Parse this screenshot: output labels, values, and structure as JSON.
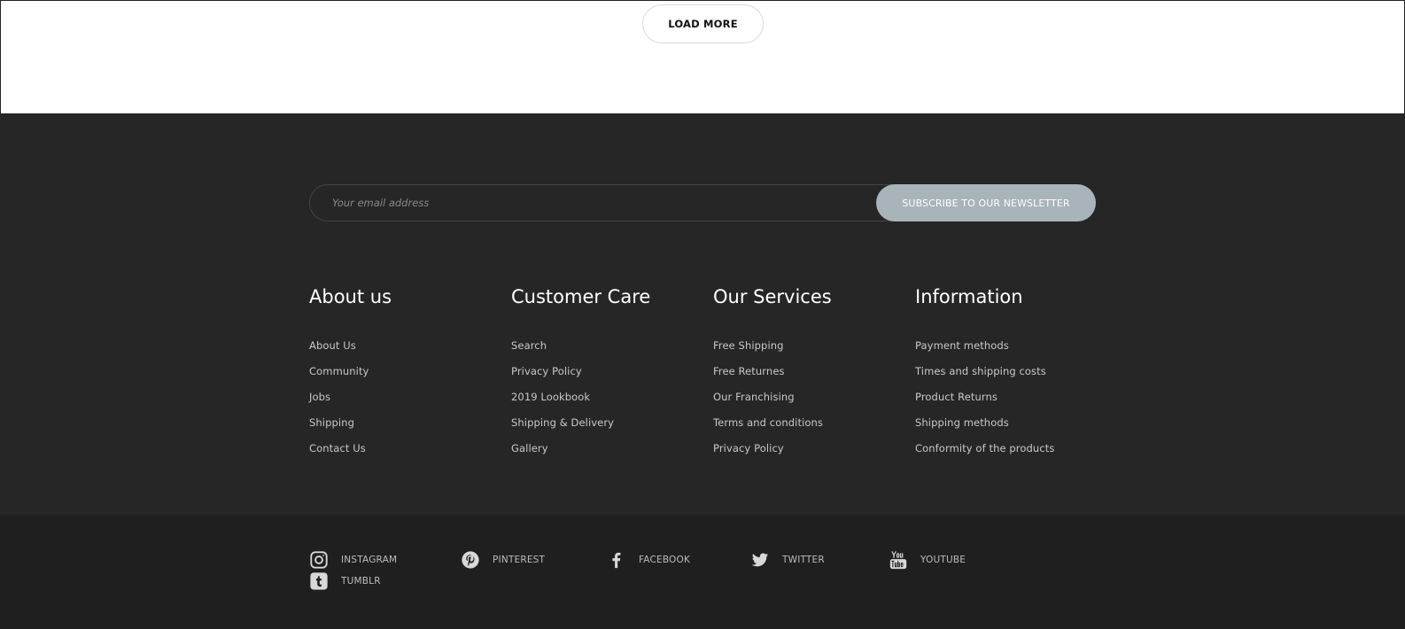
{
  "load_more": {
    "label": "LOAD MORE"
  },
  "newsletter": {
    "placeholder": "Your email address",
    "button_label": "SUBSCRIBE TO OUR NEWSLETTER"
  },
  "columns": [
    {
      "title": "About us",
      "links": [
        "About Us",
        "Community",
        "Jobs",
        "Shipping",
        "Contact Us"
      ]
    },
    {
      "title": "Customer Care",
      "links": [
        "Search",
        "Privacy Policy",
        "2019 Lookbook",
        "Shipping & Delivery",
        "Gallery"
      ]
    },
    {
      "title": "Our Services",
      "links": [
        "Free Shipping",
        "Free Returnes",
        "Our Franchising",
        "Terms and conditions",
        "Privacy Policy"
      ]
    },
    {
      "title": "Information",
      "links": [
        "Payment methods",
        "Times and shipping costs",
        "Product Returns",
        "Shipping methods",
        "Conformity of the products"
      ]
    }
  ],
  "social": [
    {
      "label": "INSTAGRAM",
      "icon": "instagram-icon"
    },
    {
      "label": "PINTEREST",
      "icon": "pinterest-icon"
    },
    {
      "label": "FACEBOOK",
      "icon": "facebook-icon"
    },
    {
      "label": "TWITTER",
      "icon": "twitter-icon"
    },
    {
      "label": "YOUTUBE",
      "icon": "youtube-icon"
    },
    {
      "label": "TUMBLR",
      "icon": "tumblr-icon"
    }
  ],
  "colors": {
    "footer_bg": "#262626",
    "footer_bottom_bg": "#1f1f1f",
    "subscribe_bg": "#a9b3ba",
    "link": "#c9c9c9"
  }
}
